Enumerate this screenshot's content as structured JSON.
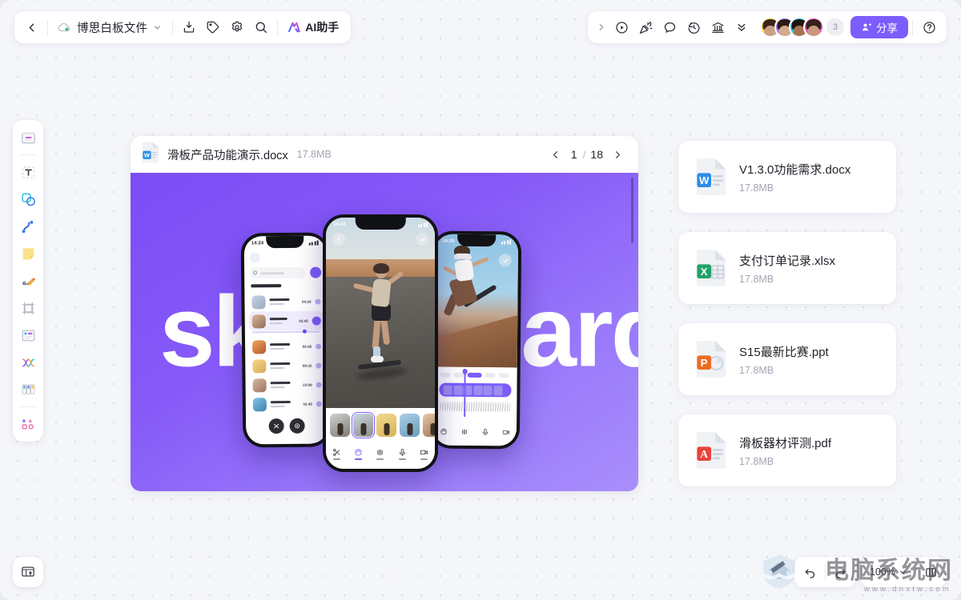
{
  "app": {
    "canvas_bg": "#f5f6fa",
    "dot_color": "#d8dae4",
    "accent": "#7c5cfa"
  },
  "toolbar_left": {
    "back_icon": "chevron-left-icon",
    "cloud_icon": "cloud-sync-icon",
    "doc_name": "博思白板文件",
    "dropdown_icon": "chevron-down-icon",
    "buttons": [
      {
        "name": "export-button",
        "icon": "download-box-icon"
      },
      {
        "name": "tag-button",
        "icon": "tag-icon"
      },
      {
        "name": "settings-button",
        "icon": "gear-icon"
      },
      {
        "name": "search-button",
        "icon": "search-icon"
      }
    ],
    "ai_label": "AI助手",
    "ai_icon": "ai-sparkle-icon"
  },
  "toolbar_right": {
    "collapse_icon": "chevron-right-icon",
    "buttons": [
      {
        "name": "present-button",
        "icon": "play-circle-icon"
      },
      {
        "name": "celebrate-button",
        "icon": "party-popper-icon"
      },
      {
        "name": "comment-button",
        "icon": "comment-bubble-icon"
      },
      {
        "name": "history-button",
        "icon": "history-clock-icon"
      },
      {
        "name": "template-button",
        "icon": "bank-columns-icon"
      },
      {
        "name": "more-button",
        "icon": "double-chevron-down-icon"
      }
    ],
    "avatars": [
      {
        "name": "avatar-1",
        "ring": "#f6c944",
        "hair": "#3a2418",
        "skin": "#caa185"
      },
      {
        "name": "avatar-2",
        "ring": "#a27cf5",
        "hair": "#2d1c14",
        "skin": "#d4ab8c"
      },
      {
        "name": "avatar-3",
        "ring": "#2ad0e8",
        "hair": "#20160f",
        "skin": "#a57551"
      },
      {
        "name": "avatar-4",
        "ring": "#f254d6",
        "hair": "#35221a",
        "skin": "#c79a7a"
      }
    ],
    "avatar_overflow": "3",
    "share_label": "分享",
    "share_icon": "user-plus-icon",
    "share_color": "#7c5cfa",
    "help_icon": "help-circle-icon"
  },
  "left_rail": {
    "items": [
      {
        "name": "tool-frame-board",
        "icon": "board-frame-icon"
      },
      {
        "name": "tool-text",
        "icon": "text-t-icon"
      },
      {
        "name": "tool-shape",
        "icon": "shapes-icon"
      },
      {
        "name": "tool-connector",
        "icon": "curve-connector-icon"
      },
      {
        "name": "tool-sticky-note",
        "icon": "sticky-note-icon"
      },
      {
        "name": "tool-pen",
        "icon": "pencil-draw-icon"
      },
      {
        "name": "tool-frame",
        "icon": "crop-frame-icon"
      },
      {
        "name": "tool-card",
        "icon": "note-card-icon"
      },
      {
        "name": "tool-mindmap",
        "icon": "mindmap-icon"
      },
      {
        "name": "tool-kanban",
        "icon": "kanban-columns-icon"
      },
      {
        "name": "tool-more-assets",
        "icon": "assets-grid-icon"
      }
    ]
  },
  "bottom_left": {
    "icon": "presentation-screen-icon",
    "name": "slides-panel-button"
  },
  "document_card": {
    "file_icon": "word-file-icon",
    "title": "滑板产品功能演示.docx",
    "size": "17.8MB",
    "prev_icon": "chevron-left-icon",
    "next_icon": "chevron-right-icon",
    "current_page": "1",
    "page_separator": "/",
    "total_pages": "18",
    "slide": {
      "word": "skateboard",
      "bg_from": "#7b4df5",
      "bg_to": "#a98efc"
    }
  },
  "files": [
    {
      "name": "V1.3.0功能需求.docx",
      "size": "17.8MB",
      "type": "word",
      "icon": "word-file-icon",
      "color": "#2b7cd3"
    },
    {
      "name": "支付订单记录.xlsx",
      "size": "17.8MB",
      "type": "excel",
      "icon": "excel-file-icon",
      "color": "#21a366"
    },
    {
      "name": "S15最新比赛.ppt",
      "size": "17.8MB",
      "type": "ppt",
      "icon": "ppt-file-icon",
      "color": "#ed6c23"
    },
    {
      "name": "滑板器材评测.pdf",
      "size": "17.8MB",
      "type": "pdf",
      "icon": "pdf-file-icon",
      "color": "#e8443a"
    }
  ],
  "bottom_bar": {
    "undo_icon": "undo-arrow-icon",
    "redo_icon": "redo-arrow-icon",
    "zoom_level": "100%",
    "zoom_chevron_icon": "chevron-down-icon",
    "layout_icon": "fit-layout-icon"
  },
  "watermark": {
    "text": "电脑系统网",
    "url": "www.dnxtw.com"
  }
}
